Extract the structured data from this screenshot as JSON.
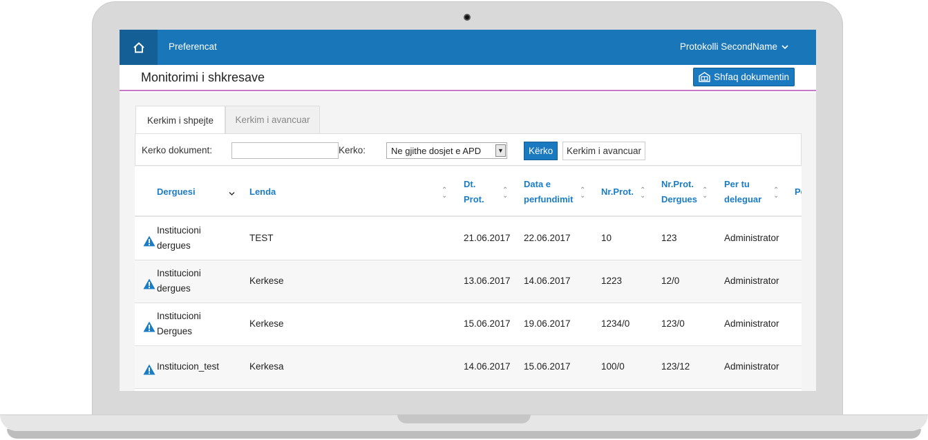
{
  "topbar": {
    "home_icon": "home-icon",
    "menu_preferences": "Preferencat",
    "user_menu": "Protokolli SecondName",
    "user_menu_icon": "chevron-down-icon",
    "color": "#1976b9"
  },
  "page": {
    "title": "Monitorimi i shkresave",
    "show_document_button": "Shfaq dokumentin",
    "show_document_icon": "document-view-icon"
  },
  "tabs": [
    {
      "label": "Kerkim i shpejte",
      "active": true
    },
    {
      "label": "Kerkim i avancuar",
      "active": false
    }
  ],
  "search": {
    "document_label": "Kerko dokument:",
    "document_value": "",
    "scope_label": "Kerko:",
    "scope_selected": "Ne gjithe dosjet e APD",
    "search_button": "Kërko",
    "advanced_button": "Kerkim i avancuar"
  },
  "table": {
    "columns": [
      {
        "line1": "Derguesi",
        "line2": ""
      },
      {
        "line1": "Lenda",
        "line2": ""
      },
      {
        "line1": "Dt.",
        "line2": "Prot."
      },
      {
        "line1": "Data e",
        "line2": "perfundimit"
      },
      {
        "line1": "Nr.Prot.",
        "line2": ""
      },
      {
        "line1": "Nr.Prot.",
        "line2": "Dergues"
      },
      {
        "line1": "Per tu",
        "line2": "deleguar"
      },
      {
        "line1": "Pe",
        "line2": ""
      }
    ],
    "rows": [
      {
        "sender1": "Institucioni",
        "sender2": "dergues",
        "subject": "TEST",
        "dt_prot": "21.06.2017",
        "end_date": "22.06.2017",
        "nr_prot": "10",
        "nr_prot_sender": "123",
        "delegate": "Administrator"
      },
      {
        "sender1": "Institucioni",
        "sender2": "dergues",
        "subject": "Kerkese",
        "dt_prot": "13.06.2017",
        "end_date": "14.06.2017",
        "nr_prot": "1223",
        "nr_prot_sender": "12/0",
        "delegate": "Administrator"
      },
      {
        "sender1": "Institucioni",
        "sender2": "Dergues",
        "subject": "Kerkese",
        "dt_prot": "15.06.2017",
        "end_date": "19.06.2017",
        "nr_prot": "1234/0",
        "nr_prot_sender": "123/0",
        "delegate": "Administrator"
      },
      {
        "sender1": "Institucion_test",
        "sender2": "",
        "subject": "Kerkesa",
        "dt_prot": "14.06.2017",
        "end_date": "15.06.2017",
        "nr_prot": "100/0",
        "nr_prot_sender": "123/12",
        "delegate": "Administrator"
      }
    ]
  }
}
